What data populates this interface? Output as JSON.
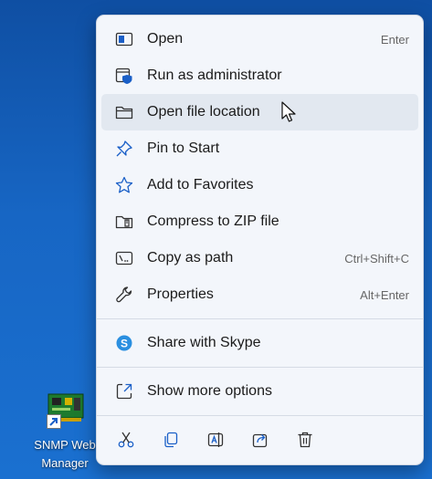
{
  "desktop": {
    "shortcut": {
      "line1": "SNMP Web",
      "line2": "Manager",
      "icon": "network-card-icon"
    }
  },
  "context_menu": {
    "items": [
      {
        "label": "Open",
        "shortcut": "Enter",
        "icon": "open-window-icon"
      },
      {
        "label": "Run as administrator",
        "shortcut": "",
        "icon": "shield-window-icon"
      },
      {
        "label": "Open file location",
        "shortcut": "",
        "icon": "folder-icon",
        "hovered": true
      },
      {
        "label": "Pin to Start",
        "shortcut": "",
        "icon": "pin-icon"
      },
      {
        "label": "Add to Favorites",
        "shortcut": "",
        "icon": "star-icon"
      },
      {
        "label": "Compress to ZIP file",
        "shortcut": "",
        "icon": "zip-folder-icon"
      },
      {
        "label": "Copy as path",
        "shortcut": "Ctrl+Shift+C",
        "icon": "path-icon"
      },
      {
        "label": "Properties",
        "shortcut": "Alt+Enter",
        "icon": "wrench-icon"
      }
    ],
    "share": {
      "label": "Share with Skype",
      "icon": "skype-icon"
    },
    "more": {
      "label": "Show more options",
      "icon": "expand-icon"
    },
    "toolbar": [
      "cut-icon",
      "copy-icon",
      "rename-icon",
      "share-icon",
      "delete-icon"
    ]
  },
  "colors": {
    "accent": "#1a5fc7",
    "skype": "#2a8fe0",
    "desktop": "#1766c4",
    "menu_bg": "#f3f6fb"
  }
}
